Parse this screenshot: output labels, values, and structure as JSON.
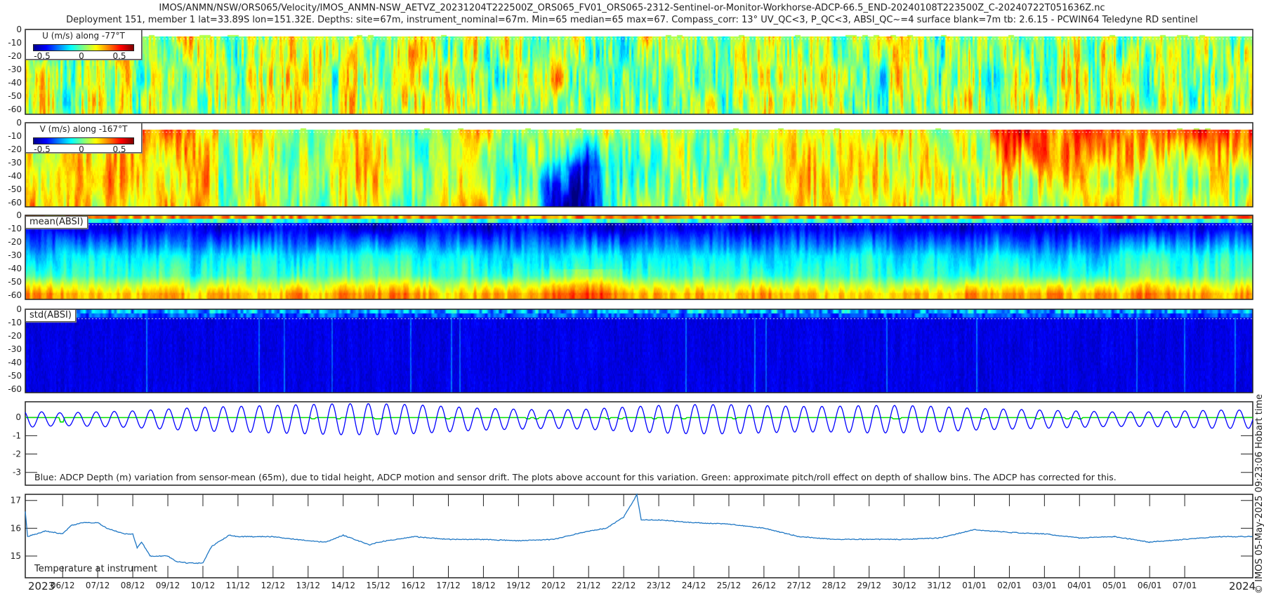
{
  "header": {
    "title_line1": "IMOS/ANMN/NSW/ORS065/Velocity/IMOS_ANMN-NSW_AETVZ_20231204T222500Z_ORS065_FV01_ORS065-2312-Sentinel-or-Monitor-Workhorse-ADCP-66.5_END-20240108T223500Z_C-20240722T051636Z.nc",
    "title_line2": "Deployment 151, member 1 lat=33.89S lon=151.32E. Depths: site=67m, instrument_nominal=67m. Min=65 median=65 max=67. Compass_corr: 13° UV_QC<3, P_QC<3, ABSI_QC~=4 surface blank=7m tb: 2.6.15 - PCWIN64 Teledyne RD sentinel"
  },
  "credit": "© IMOS 05-May-2025 09:23:06 Hobart time",
  "colors": {
    "axis": "#222222",
    "depth_line": "#0000ff",
    "pitch_roll_line": "#00e000",
    "temperature_line": "#1f77c4",
    "colormap": "jet"
  },
  "time_axis": {
    "start": "2023-12-04T22:25",
    "end": "2024-01-08T22:35",
    "year_left": "2023",
    "year_right": "2024",
    "tick_labels": [
      "06/12",
      "07/12",
      "08/12",
      "09/12",
      "10/12",
      "11/12",
      "12/12",
      "13/12",
      "14/12",
      "15/12",
      "16/12",
      "17/12",
      "18/12",
      "19/12",
      "20/12",
      "21/12",
      "22/12",
      "23/12",
      "24/12",
      "25/12",
      "26/12",
      "27/12",
      "28/12",
      "29/12",
      "30/12",
      "31/12",
      "01/01",
      "02/01",
      "03/01",
      "04/01",
      "05/01",
      "06/01",
      "07/01"
    ]
  },
  "chart_data": [
    {
      "type": "heatmap",
      "id": "u",
      "title": "U (m/s) along -77°T",
      "colorbar_ticks": [
        "-0.5",
        "0",
        "0.5"
      ],
      "clim": [
        -0.7,
        0.7
      ],
      "y_ticks": [
        "0",
        "-10",
        "-20",
        "-30",
        "-40",
        "-50",
        "-60"
      ],
      "surface_blank_m": 7
    },
    {
      "type": "heatmap",
      "id": "v",
      "title": "V (m/s) along -167°T",
      "colorbar_ticks": [
        "-0.5",
        "0",
        "0.5"
      ],
      "clim": [
        -0.7,
        0.7
      ],
      "y_ticks": [
        "0",
        "-10",
        "-20",
        "-30",
        "-40",
        "-50",
        "-60"
      ],
      "surface_blank_m": 7
    },
    {
      "type": "heatmap",
      "id": "mean",
      "title": "mean(ABSI)",
      "y_ticks": [
        "0",
        "-10",
        "-20",
        "-30",
        "-40",
        "-50",
        "-60"
      ]
    },
    {
      "type": "heatmap",
      "id": "std",
      "title": "std(ABSI)",
      "y_ticks": [
        "0",
        "-10",
        "-20",
        "-30",
        "-40",
        "-50",
        "-60"
      ]
    },
    {
      "type": "line",
      "id": "depth",
      "annotation": "Blue: ADCP Depth (m) variation from sensor-mean (65m), due to tidal height, ADCP motion and sensor drift. The plots above account for this variation. Green: approximate pitch/roll effect on depth of shallow bins. The ADCP has corrected for this.",
      "y_ticks": [
        "0",
        "-1",
        "-2",
        "-3"
      ],
      "ylim": [
        -0.85,
        3.7
      ],
      "tide_period_hours": 12.42,
      "series": [
        {
          "color": "#0000ff",
          "mean_offset_m": 0.1,
          "daily_tidal_amplitude_m": [
            0.45,
            0.35,
            0.4,
            0.45,
            0.55,
            0.65,
            0.7,
            0.75,
            0.8,
            0.85,
            0.85,
            0.8,
            0.7,
            0.6,
            0.55,
            0.5,
            0.55,
            0.65,
            0.75,
            0.8,
            0.8,
            0.75,
            0.7,
            0.7,
            0.75,
            0.75,
            0.7,
            0.6,
            0.55,
            0.5,
            0.45,
            0.4,
            0.4,
            0.45,
            0.5
          ]
        },
        {
          "color": "#00e000",
          "value_m": 0
        }
      ]
    },
    {
      "type": "line",
      "id": "temperature",
      "annotation": "Temperature at instrument",
      "y_ticks": [
        "17",
        "16",
        "15"
      ],
      "ylim": [
        14.22,
        17.22
      ],
      "x": [
        "2023-12-04T22:25",
        "2023-12-05T00:00",
        "2023-12-05T12:00",
        "2023-12-06T00:00",
        "2023-12-06T06:00",
        "2023-12-06T14:00",
        "2023-12-07T00:00",
        "2023-12-07T06:00",
        "2023-12-07T18:00",
        "2023-12-08T00:00",
        "2023-12-08T03:00",
        "2023-12-08T06:00",
        "2023-12-08T12:00",
        "2023-12-09T00:00",
        "2023-12-09T06:00",
        "2023-12-09T14:00",
        "2023-12-10T00:00",
        "2023-12-10T06:00",
        "2023-12-10T18:00",
        "2023-12-11T00:00",
        "2023-12-12T00:00",
        "2023-12-13T00:00",
        "2023-12-13T12:00",
        "2023-12-14T00:00",
        "2023-12-14T18:00",
        "2023-12-15T00:00",
        "2023-12-16T00:00",
        "2023-12-17T00:00",
        "2023-12-18T00:00",
        "2023-12-19T00:00",
        "2023-12-20T00:00",
        "2023-12-21T00:00",
        "2023-12-21T12:00",
        "2023-12-22T00:00",
        "2023-12-22T09:00",
        "2023-12-22T12:00",
        "2023-12-23T00:00",
        "2023-12-24T00:00",
        "2023-12-25T00:00",
        "2023-12-26T00:00",
        "2023-12-27T00:00",
        "2023-12-28T00:00",
        "2023-12-29T00:00",
        "2023-12-30T00:00",
        "2023-12-31T00:00",
        "2024-01-01T00:00",
        "2024-01-02T00:00",
        "2024-01-03T00:00",
        "2024-01-04T00:00",
        "2024-01-05T00:00",
        "2024-01-06T00:00",
        "2024-01-07T00:00",
        "2024-01-08T00:00",
        "2024-01-08T22:35"
      ],
      "y": [
        16.6,
        15.7,
        15.9,
        15.8,
        16.1,
        16.2,
        16.2,
        16.0,
        15.8,
        15.8,
        15.3,
        15.5,
        15.0,
        15.0,
        14.8,
        14.75,
        14.75,
        15.35,
        15.75,
        15.7,
        15.7,
        15.55,
        15.5,
        15.75,
        15.4,
        15.5,
        15.7,
        15.6,
        15.6,
        15.55,
        15.6,
        15.9,
        16.0,
        16.4,
        17.2,
        16.3,
        16.3,
        16.2,
        16.15,
        16.0,
        15.7,
        15.6,
        15.6,
        15.6,
        15.65,
        15.95,
        15.85,
        15.8,
        15.65,
        15.7,
        15.5,
        15.6,
        15.7,
        15.7
      ]
    }
  ]
}
